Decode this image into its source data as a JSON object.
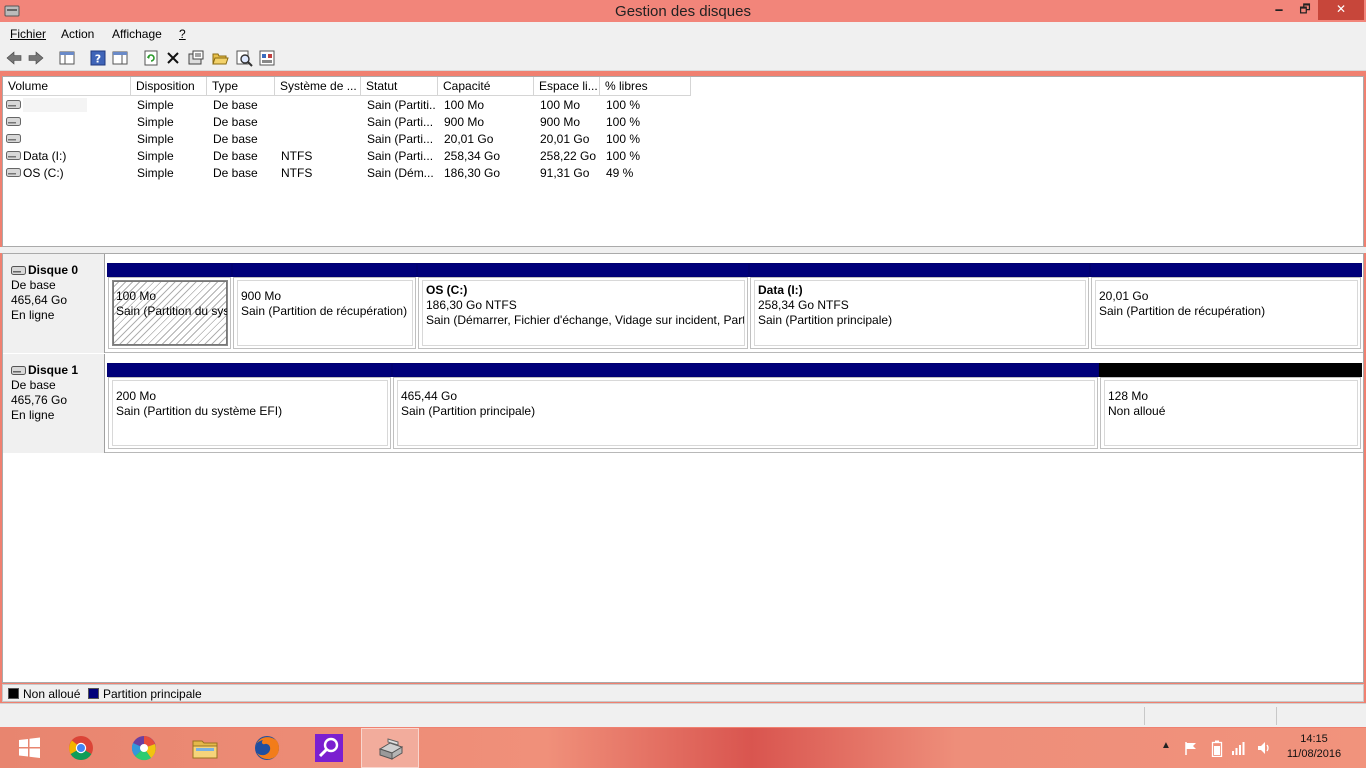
{
  "window": {
    "title": "Gestion des disques",
    "min_label": "🗕",
    "max_label": "🗗",
    "close_label": "✕"
  },
  "menu": {
    "items": [
      "Fichier",
      "Action",
      "Affichage",
      "?"
    ]
  },
  "toolbar": {
    "buttons": [
      "back-icon",
      "forward-icon",
      "console-tree-icon",
      "help-icon",
      "properties-pane-icon",
      "refresh-icon",
      "delete-icon",
      "properties-icon",
      "open-icon",
      "explore-icon",
      "export-icon"
    ]
  },
  "volume_list": {
    "columns": [
      "Volume",
      "Disposition",
      "Type",
      "Système de ...",
      "Statut",
      "Capacité",
      "Espace li...",
      "% libres"
    ],
    "rows": [
      [
        "",
        "Simple",
        "De base",
        "",
        "Sain (Partiti...",
        "100 Mo",
        "100 Mo",
        "100 %"
      ],
      [
        "",
        "Simple",
        "De base",
        "",
        "Sain (Parti...",
        "900 Mo",
        "900 Mo",
        "100 %"
      ],
      [
        "",
        "Simple",
        "De base",
        "",
        "Sain (Parti...",
        "20,01 Go",
        "20,01 Go",
        "100 %"
      ],
      [
        "Data (I:)",
        "Simple",
        "De base",
        "NTFS",
        "Sain (Parti...",
        "258,34 Go",
        "258,22 Go",
        "100 %"
      ],
      [
        "OS (C:)",
        "Simple",
        "De base",
        "NTFS",
        "Sain (Dém...",
        "186,30 Go",
        "91,31 Go",
        "49 %"
      ]
    ]
  },
  "disks": [
    {
      "name": "Disque 0",
      "type": "De base",
      "size": "465,64 Go",
      "state": "En ligne",
      "partitions": [
        {
          "title": "",
          "size": "100 Mo",
          "status": "Sain (Partition du système EFI)"
        },
        {
          "title": "",
          "size": "900 Mo",
          "status": "Sain (Partition de récupération)"
        },
        {
          "title": "OS  (C:)",
          "size": "186,30 Go NTFS",
          "status": "Sain (Démarrer, Fichier d'échange, Vidage sur incident, Partition principale)"
        },
        {
          "title": "Data  (I:)",
          "size": "258,34 Go NTFS",
          "status": "Sain (Partition principale)"
        },
        {
          "title": "",
          "size": "20,01 Go",
          "status": "Sain (Partition de récupération)"
        }
      ]
    },
    {
      "name": "Disque 1",
      "type": "De base",
      "size": "465,76 Go",
      "state": "En ligne",
      "partitions": [
        {
          "title": "",
          "size": "200 Mo",
          "status": "Sain (Partition du système EFI)"
        },
        {
          "title": "",
          "size": "465,44 Go",
          "status": "Sain (Partition principale)"
        },
        {
          "title": "",
          "size": "128 Mo",
          "status": "Non alloué"
        }
      ]
    }
  ],
  "legend": {
    "items": [
      {
        "label": "Non alloué",
        "color": "#000000"
      },
      {
        "label": "Partition principale",
        "color": "#00007a"
      }
    ]
  },
  "taskbar": {
    "apps": [
      "windows-start-icon",
      "chrome-icon",
      "picasa-icon",
      "file-explorer-icon",
      "firefox-icon",
      "search-app-icon",
      "disk-management-icon"
    ],
    "tray_icons": [
      "show-hidden-icons-icon",
      "action-center-flag-icon",
      "battery-icon",
      "network-signal-icon",
      "volume-icon"
    ],
    "clock_time": "14:15",
    "clock_date": "11/08/2016"
  },
  "colors": {
    "title_bar": "#f2857a",
    "primary_partition": "#00007a",
    "unallocated": "#000000"
  }
}
